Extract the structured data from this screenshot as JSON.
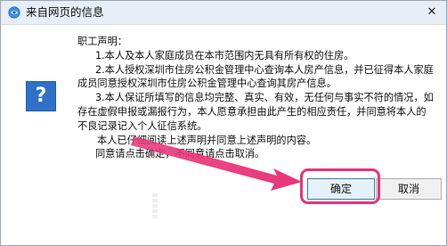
{
  "window": {
    "title": "来自网页的信息",
    "close_glyph": "✕"
  },
  "icon": {
    "question_glyph": "?"
  },
  "message": {
    "lines": [
      "职工声明：",
      "1.本人及本人家庭成员在本市范围内无具有所有权的住房。",
      "2.本人授权深圳市住房公积金管理中心查询本人房产信息，并已征得本人家庭",
      "成员同意授权深圳市住房公积金管理中心查询其房产信息。",
      "3.本人保证所填写的信息均完整、真实、有效，无任何与事实不符的情况，如",
      "存在虚假申报或漏报行为，本人愿意承担由此产生的相应责任，并同意将本人的",
      "不良记录记入个人征信系统。",
      "本人已仔细阅读上述声明并同意上述声明的内容。",
      "同意请点击确定，不同意请点击取消。"
    ]
  },
  "buttons": {
    "ok_label": "确定",
    "cancel_label": "取消"
  },
  "colors": {
    "accent": "#2f71c8",
    "highlight": "#e8347a"
  }
}
